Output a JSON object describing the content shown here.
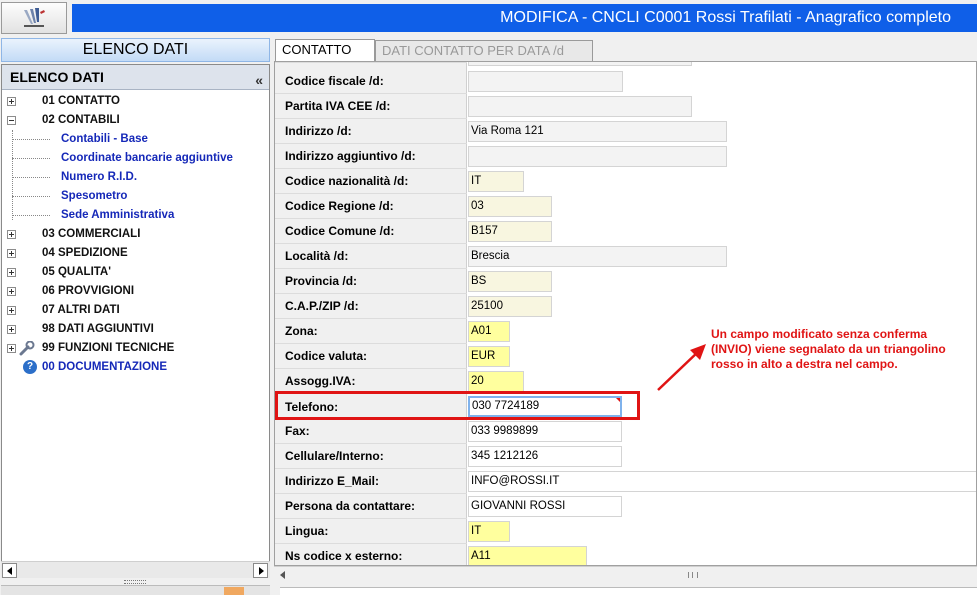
{
  "window": {
    "title": "MODIFICA - CNCLI C0001 Rossi Trafilati - Anagrafico completo",
    "logo_icon": "app-logo-icon"
  },
  "left_panel": {
    "header": "ELENCO DATI",
    "tree_title": "ELENCO DATI",
    "collapse_glyph": "«",
    "items": [
      {
        "label": "01 CONTATTO",
        "state": "collapsed"
      },
      {
        "label": "02 CONTABILI",
        "state": "expanded",
        "children": [
          "Contabili - Base",
          "Coordinate bancarie aggiuntive",
          "Numero R.I.D.",
          "Spesometro",
          "Sede Amministrativa"
        ]
      },
      {
        "label": "03 COMMERCIALI",
        "state": "collapsed"
      },
      {
        "label": "04 SPEDIZIONE",
        "state": "collapsed"
      },
      {
        "label": "05 QUALITA'",
        "state": "collapsed"
      },
      {
        "label": "06 PROVVIGIONI",
        "state": "collapsed"
      },
      {
        "label": "07 ALTRI DATI",
        "state": "collapsed"
      },
      {
        "label": "98 DATI AGGIUNTIVI",
        "state": "collapsed"
      },
      {
        "label": "99 FUNZIONI TECNICHE",
        "state": "collapsed",
        "icon": "wrench-icon"
      },
      {
        "label": "00 DOCUMENTAZIONE",
        "icon": "help-icon",
        "icon_glyph": "?"
      }
    ]
  },
  "tabs": [
    {
      "label": "CONTATTO",
      "active": true
    },
    {
      "label": "DATI CONTATTO PER DATA /d",
      "active": false
    }
  ],
  "form": {
    "fields": [
      {
        "label": "Codice fiscale /d:",
        "value": ""
      },
      {
        "label": "Partita IVA CEE /d:",
        "value": ""
      },
      {
        "label": "Indirizzo /d:",
        "value": "Via Roma 121"
      },
      {
        "label": "Indirizzo aggiuntivo /d:",
        "value": ""
      },
      {
        "label": "Codice nazionalità /d:",
        "value": "IT"
      },
      {
        "label": "Codice Regione /d:",
        "value": "03"
      },
      {
        "label": "Codice Comune /d:",
        "value": "B157"
      },
      {
        "label": "Località /d:",
        "value": "Brescia"
      },
      {
        "label": "Provincia /d:",
        "value": "BS"
      },
      {
        "label": "C.A.P./ZIP /d:",
        "value": "25100"
      },
      {
        "label": "Zona:",
        "value": "A01"
      },
      {
        "label": "Codice valuta:",
        "value": "EUR"
      },
      {
        "label": "Assogg.IVA:",
        "value": "20"
      },
      {
        "label": "Telefono:",
        "value": "030 7724189",
        "modified_unconfirmed": true
      },
      {
        "label": "Fax:",
        "value": "033 9989899"
      },
      {
        "label": "Cellulare/Interno:",
        "value": "345 1212126"
      },
      {
        "label": "Indirizzo E_Mail:",
        "value": "INFO@ROSSI.IT"
      },
      {
        "label": "Persona da contattare:",
        "value": "GIOVANNI ROSSI"
      },
      {
        "label": "Lingua:",
        "value": "IT"
      },
      {
        "label": "Ns codice x esterno:",
        "value": "A11"
      }
    ]
  },
  "annotation": {
    "text": "Un campo modificato senza conferma (INVIO) viene segnalato da un triangolino rosso in alto a destra nel campo.",
    "color": "#e01414"
  },
  "colors": {
    "title_bar": "#0f5fe8",
    "tree_child": "#1528b8",
    "highlight": "#e01414",
    "field_yellow": "#ffff9e",
    "field_cream": "#f8f6e0"
  }
}
